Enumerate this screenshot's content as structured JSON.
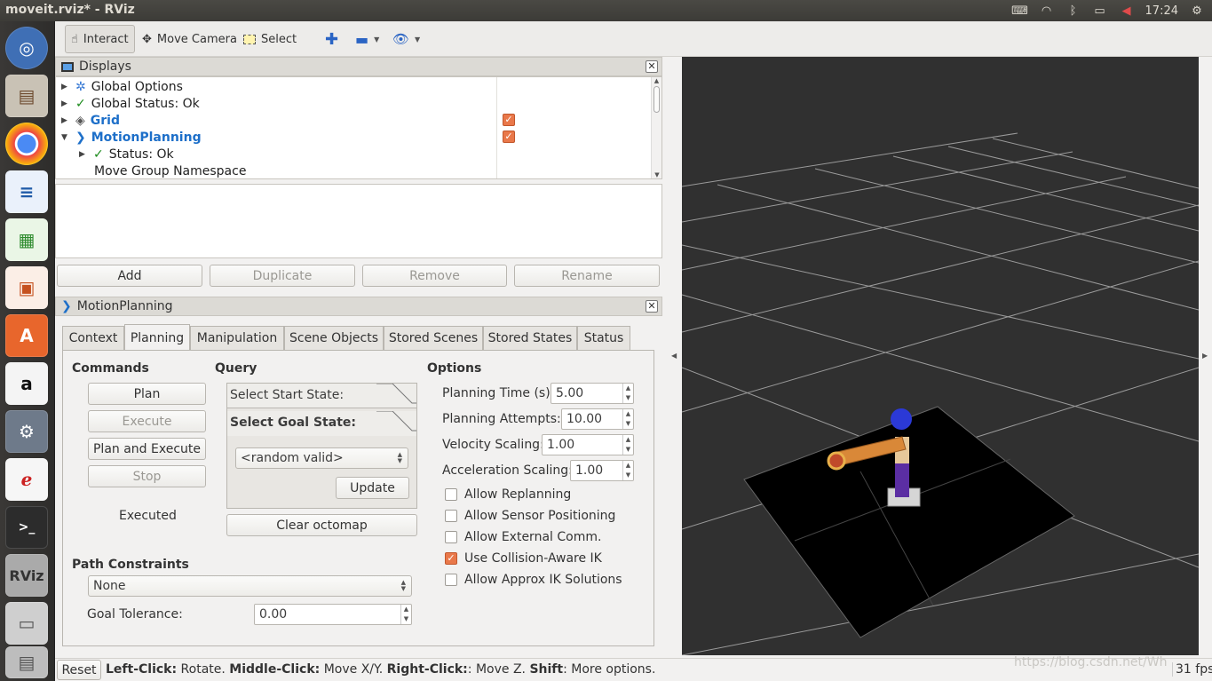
{
  "window": {
    "title": "moveit.rviz* - RViz",
    "clock": "17:24"
  },
  "toolbar": {
    "interact": "Interact",
    "move_camera": "Move Camera",
    "select": "Select"
  },
  "displays": {
    "title": "Displays",
    "tree": [
      {
        "label": "Global Options"
      },
      {
        "label": "Global Status: Ok"
      },
      {
        "label": "Grid"
      },
      {
        "label": "MotionPlanning"
      },
      {
        "label": "Status: Ok"
      },
      {
        "label": "Move Group Namespace"
      }
    ],
    "buttons": {
      "add": "Add",
      "duplicate": "Duplicate",
      "remove": "Remove",
      "rename": "Rename"
    }
  },
  "motion_planning": {
    "title": "MotionPlanning",
    "tabs": [
      "Context",
      "Planning",
      "Manipulation",
      "Scene Objects",
      "Stored Scenes",
      "Stored States",
      "Status"
    ],
    "commands": {
      "heading": "Commands",
      "plan": "Plan",
      "execute": "Execute",
      "plan_and_execute": "Plan and Execute",
      "stop": "Stop",
      "status": "Executed"
    },
    "query": {
      "heading": "Query",
      "start_state": "Select Start State:",
      "goal_state": "Select Goal State:",
      "goal_value": "<random valid>",
      "update": "Update",
      "clear_octomap": "Clear octomap"
    },
    "options": {
      "heading": "Options",
      "planning_time_label": "Planning Time (s):",
      "planning_time": "5.00",
      "planning_attempts_label": "Planning Attempts:",
      "planning_attempts": "10.00",
      "velocity_label": "Velocity Scaling:",
      "velocity": "1.00",
      "acceleration_label": "Acceleration Scaling:",
      "acceleration": "1.00",
      "checkboxes": [
        {
          "label": "Allow Replanning",
          "checked": false
        },
        {
          "label": "Allow Sensor Positioning",
          "checked": false
        },
        {
          "label": "Allow External Comm.",
          "checked": false
        },
        {
          "label": "Use Collision-Aware IK",
          "checked": true
        },
        {
          "label": "Allow Approx IK Solutions",
          "checked": false
        }
      ]
    },
    "path_constraints": {
      "heading": "Path Constraints",
      "value": "None",
      "goal_tolerance_label": "Goal Tolerance:",
      "goal_tolerance": "0.00"
    }
  },
  "statusbar": {
    "reset": "Reset",
    "left_click": "Left-Click:",
    "left_action": " Rotate. ",
    "middle_click": "Middle-Click:",
    "middle_action": " Move X/Y. ",
    "right_click": "Right-Click:",
    "right_action": ": Move Z. ",
    "shift": "Shift",
    "shift_action": ": More options.",
    "watermark": "https://blog.csdn.net/Wh",
    "fps": "31 fps"
  },
  "colors": {
    "accent": "#e9784a",
    "link_blue": "#1d6fc9",
    "viewport": "#303030"
  }
}
